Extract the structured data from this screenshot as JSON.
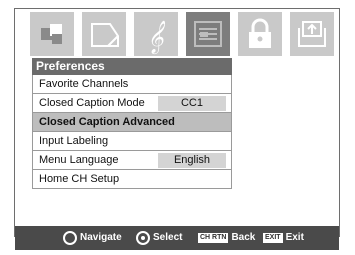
{
  "icons": [
    {
      "name": "picture-icon",
      "active": false
    },
    {
      "name": "picture-settings-icon",
      "active": false
    },
    {
      "name": "audio-icon",
      "active": false
    },
    {
      "name": "preferences-icon",
      "active": true
    },
    {
      "name": "lock-icon",
      "active": false
    },
    {
      "name": "setup-icon",
      "active": false
    }
  ],
  "panel": {
    "title": "Preferences"
  },
  "menu": {
    "favorite_channels": "Favorite Channels",
    "closed_caption_mode": "Closed Caption Mode",
    "closed_caption_mode_value": "CC1",
    "closed_caption_advanced": "Closed Caption Advanced",
    "input_labeling": "Input Labeling",
    "menu_language": "Menu Language",
    "menu_language_value": "English",
    "home_ch_setup": "Home CH Setup"
  },
  "footer": {
    "navigate": "Navigate",
    "select": "Select",
    "back_key": "CH RTN",
    "back": "Back",
    "exit_key": "EXIT",
    "exit": "Exit"
  },
  "colors": {
    "tab_inactive": "#c9c9c9",
    "tab_active": "#7d7d7d",
    "title_bar": "#6b6b6b",
    "highlight_row": "#bdbdbd",
    "footer_bg": "#4a4a4a"
  }
}
